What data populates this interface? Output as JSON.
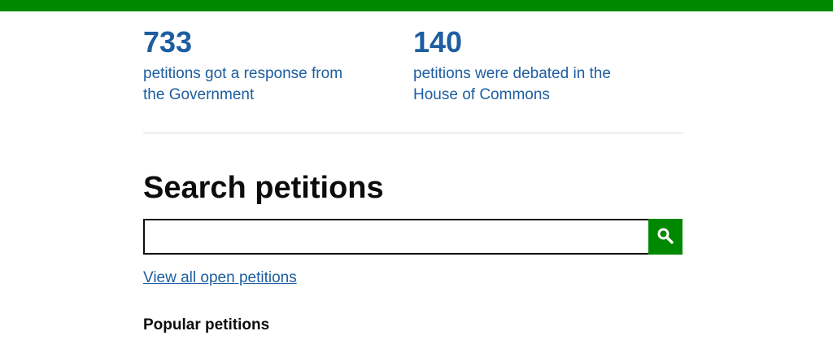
{
  "stats": [
    {
      "number": "733",
      "description": "petitions got a response from the Government"
    },
    {
      "number": "140",
      "description": "petitions were debated in the House of Commons"
    }
  ],
  "search": {
    "heading": "Search petitions",
    "value": "",
    "placeholder": "",
    "button_icon": "search-icon"
  },
  "links": {
    "view_all": "View all open petitions"
  },
  "popular": {
    "heading": "Popular petitions"
  },
  "colors": {
    "brand_green": "#008800",
    "link_blue": "#1d5ea0",
    "text": "#0b0c0c"
  }
}
